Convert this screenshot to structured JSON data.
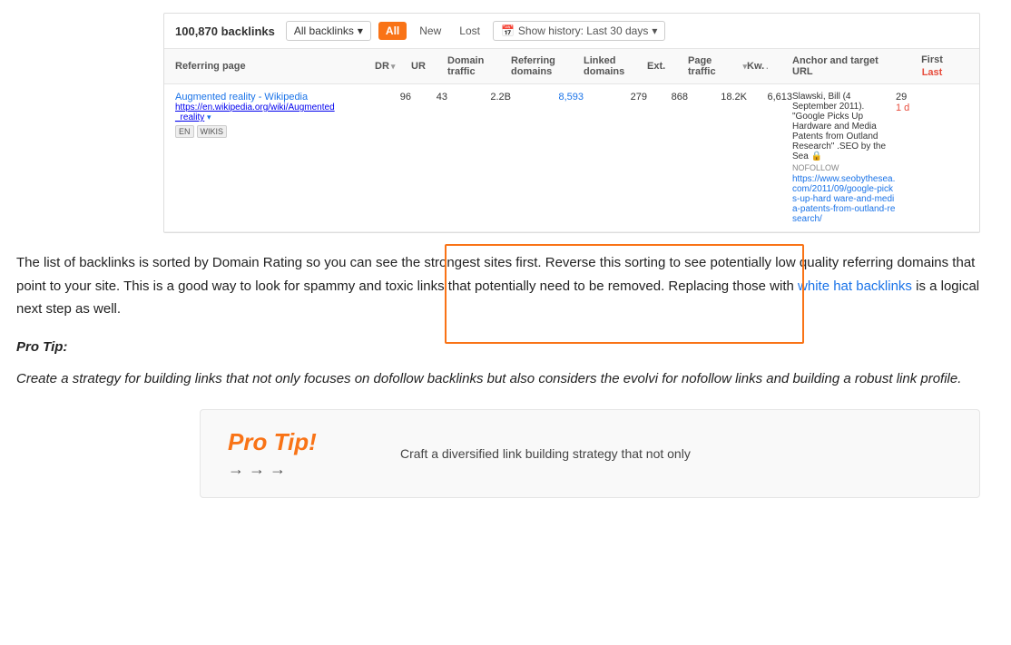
{
  "table": {
    "backlinks_count": "100,870 backlinks",
    "filter_all": "All",
    "filter_new": "New",
    "filter_lost": "Lost",
    "history_btn": "Show history: Last 30 days",
    "all_backlinks_btn": "All backlinks",
    "columns": [
      "Referring page",
      "DR",
      "UR",
      "Domain traffic",
      "Referring domains",
      "Linked domains",
      "Ext.",
      "Page traffic",
      "Kw.",
      "Anchor and target URL",
      "First / Last"
    ],
    "row": {
      "page_title": "Augmented reality - Wikipedia",
      "page_url": "https://en.wikipedia.org/wiki/Augmented_reality",
      "url_suffix": "_reality",
      "tags": [
        "EN",
        "WIKIS"
      ],
      "dr": "96",
      "ur": "43",
      "domain_traffic": "2.2B",
      "referring_domains": "8,593",
      "linked_domains": "279",
      "ext": "868",
      "page_traffic": "18.2K",
      "kw": "6,613",
      "anchor_text": "Slawski, Bill (4 September 2011). \"Google Picks Up Hardware and Media Patents from Outland Research\" .SEO by the Sea",
      "nofollow": "NOFOLLOW",
      "target_url": "https://www.seobythesea.com/2011/09/google-picks-up-hard ware-and-media-patents-from-outland-research/",
      "first": "29",
      "last": "1 d",
      "last_color": "red"
    }
  },
  "body": {
    "paragraph1": "The list of backlinks is sorted by Domain Rating so you can see the strongest sites first. Reverse this sorting to see potentially low quality referring domains that point to your site. This is a good way to look for spammy and toxic links that potentially need to be removed. Replacing those with",
    "link_text": "white hat backlinks",
    "paragraph1_end": "is a logical next step as well.",
    "pro_tip_label": "Pro Tip:",
    "italic_paragraph": "Create a strategy for building links that not only focuses on dofollow backlinks but also considers the evolvi for nofollow links and building a robust link profile.",
    "pro_tip_box_title": "Pro Tip!",
    "pro_tip_arrows": "→ → →",
    "pro_tip_body": "Craft a diversified link building strategy that not only"
  },
  "icons": {
    "calendar": "📅",
    "chevron_down": "▾",
    "sort": "▾",
    "lock": "🔒"
  }
}
